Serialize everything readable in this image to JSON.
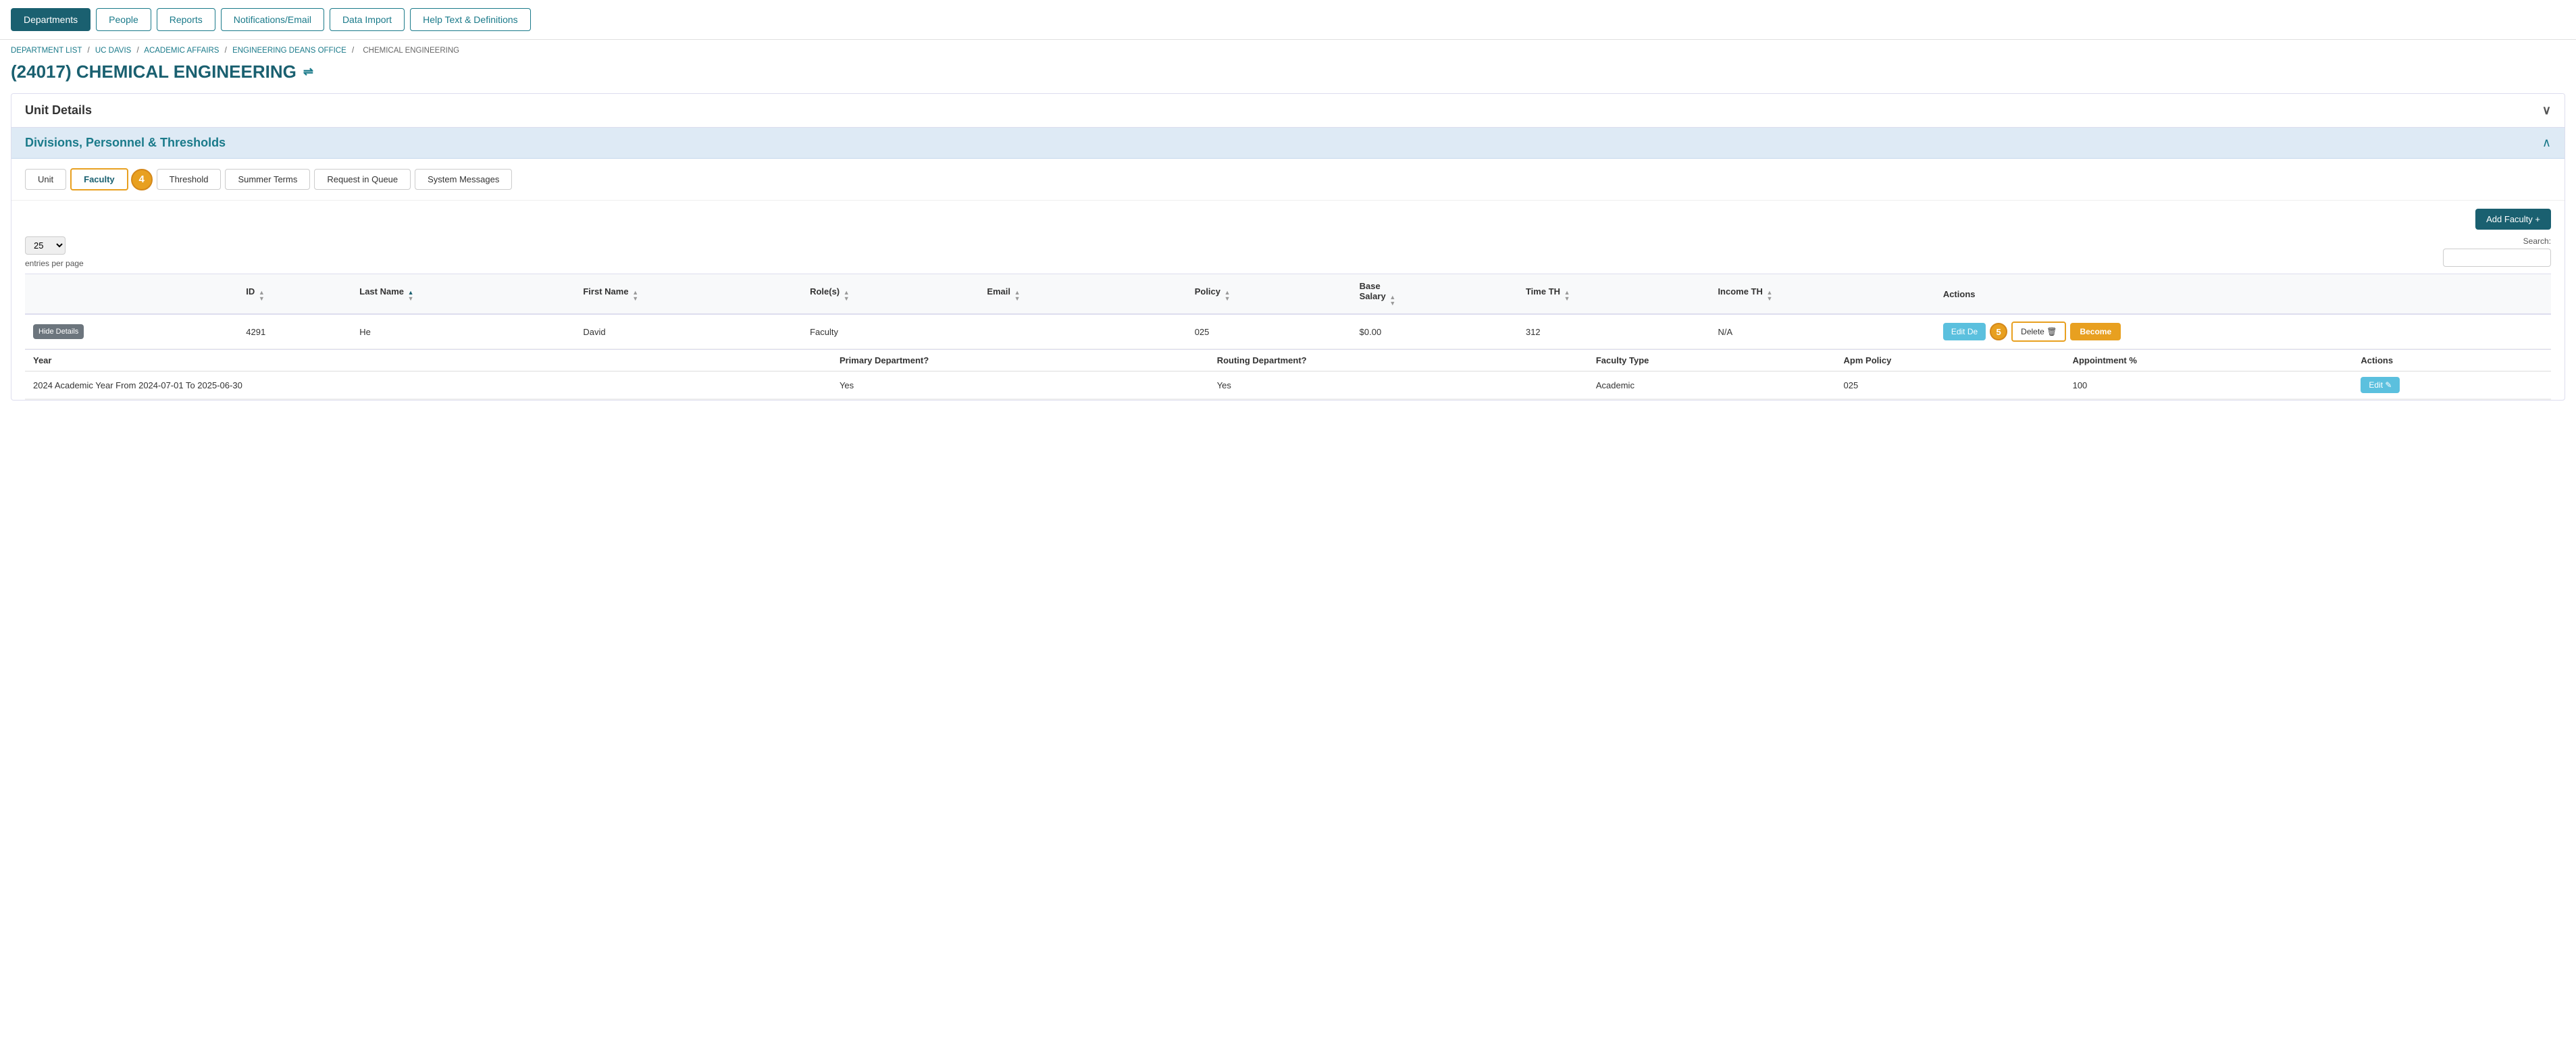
{
  "nav": {
    "items": [
      {
        "label": "Departments",
        "active": true
      },
      {
        "label": "People",
        "active": false
      },
      {
        "label": "Reports",
        "active": false
      },
      {
        "label": "Notifications/Email",
        "active": false
      },
      {
        "label": "Data Import",
        "active": false
      },
      {
        "label": "Help Text & Definitions",
        "active": false
      }
    ]
  },
  "breadcrumb": {
    "items": [
      {
        "label": "DEPARTMENT LIST",
        "link": true
      },
      {
        "label": "UC DAVIS",
        "link": true
      },
      {
        "label": "ACADEMIC AFFAIRS",
        "link": true
      },
      {
        "label": "ENGINEERING DEANS OFFICE",
        "link": true
      },
      {
        "label": "CHEMICAL ENGINEERING",
        "link": false
      }
    ]
  },
  "page_title": "(24017) CHEMICAL ENGINEERING",
  "tree_icon": "⇌",
  "unit_details_label": "Unit Details",
  "divisions_label": "Divisions, Personnel & Thresholds",
  "tabs": [
    {
      "label": "Unit",
      "active": false
    },
    {
      "label": "Faculty",
      "active": true,
      "badge": "4"
    },
    {
      "label": "Threshold",
      "active": false
    },
    {
      "label": "Summer Terms",
      "active": false
    },
    {
      "label": "Request in Queue",
      "active": false
    },
    {
      "label": "System Messages",
      "active": false
    }
  ],
  "add_faculty_label": "Add Faculty +",
  "entries_value": "25",
  "entries_label": "entries per page",
  "search_label": "Search:",
  "table": {
    "columns": [
      {
        "label": "ID",
        "sortable": true
      },
      {
        "label": "Last Name",
        "sortable": true
      },
      {
        "label": "First Name",
        "sortable": true
      },
      {
        "label": "Role(s)",
        "sortable": true
      },
      {
        "label": "Email",
        "sortable": true
      },
      {
        "label": "Policy",
        "sortable": true
      },
      {
        "label": "Base Salary",
        "sortable": true
      },
      {
        "label": "Time TH",
        "sortable": true
      },
      {
        "label": "Income TH",
        "sortable": true
      },
      {
        "label": "Actions",
        "sortable": false
      }
    ],
    "rows": [
      {
        "id": "4291",
        "last_name": "He",
        "first_name": "David",
        "roles": "Faculty",
        "email": "••••••••••••••",
        "policy": "025",
        "base_salary": "$0.00",
        "time_th": "312",
        "income_th": "N/A",
        "hide_details_label": "Hide Details"
      }
    ]
  },
  "detail_table": {
    "columns": [
      {
        "label": "Year"
      },
      {
        "label": "Primary Department?"
      },
      {
        "label": "Routing Department?"
      },
      {
        "label": "Faculty Type"
      },
      {
        "label": "Apm Policy"
      },
      {
        "label": "Appointment %"
      },
      {
        "label": "Actions"
      }
    ],
    "rows": [
      {
        "year": "2024 Academic Year From 2024-07-01 To 2025-06-30",
        "primary_dept": "Yes",
        "routing_dept": "Yes",
        "faculty_type": "Academic",
        "apm_policy": "025",
        "appointment_pct": "100",
        "edit_label": "Edit ✎"
      }
    ]
  },
  "buttons": {
    "edit_label": "Edit De",
    "delete_label": "Delete 🗑",
    "become_label": "Become"
  },
  "badge_number": "5"
}
